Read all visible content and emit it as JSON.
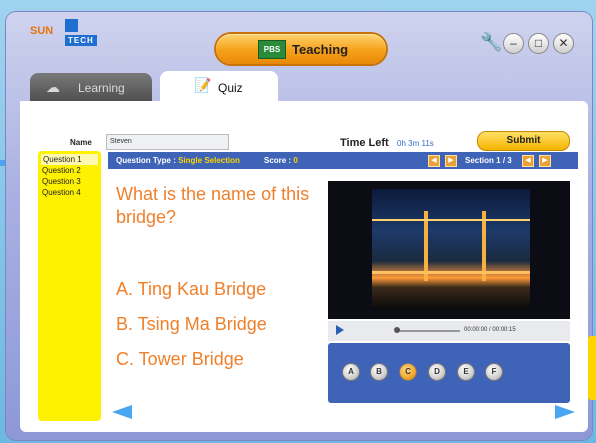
{
  "brand": {
    "line1": "SUN",
    "line2": "TECH"
  },
  "mode": {
    "badge": "PBS",
    "label": "Teaching"
  },
  "window": {
    "tool_icon": "wrench-icon",
    "min": "–",
    "max": "□",
    "close": "✕"
  },
  "tabs": [
    {
      "label": "Learning",
      "icon": "cloud-icon",
      "active": false
    },
    {
      "label": "Quiz",
      "icon": "notepad-icon",
      "active": true
    }
  ],
  "student": {
    "name_label": "Name",
    "name_value": "Steven"
  },
  "timer": {
    "label": "Time Left",
    "value": "0h 3m 11s"
  },
  "submit_label": "Submit",
  "questions": [
    "Question 1",
    "Question 2",
    "Question 3",
    "Question 4"
  ],
  "infobar": {
    "type_label": "Question Type :",
    "type_value": "Single Selection",
    "score_label": "Score :",
    "score_value": "0",
    "section_label": "Section",
    "section_value": "1 / 3"
  },
  "question_text": "What is the name of this bridge?",
  "options": [
    "A. Ting Kau Bridge",
    "B. Tsing Ma Bridge",
    "C. Tower Bridge"
  ],
  "player": {
    "time": "00:00:00 / 00:00:15"
  },
  "answer_buttons": [
    "A",
    "B",
    "C",
    "D",
    "E",
    "F"
  ],
  "selected_answer": "C",
  "colors": {
    "accent_orange": "#f07f2a",
    "bar_blue": "#3f63b6",
    "list_yellow": "#fff200"
  }
}
